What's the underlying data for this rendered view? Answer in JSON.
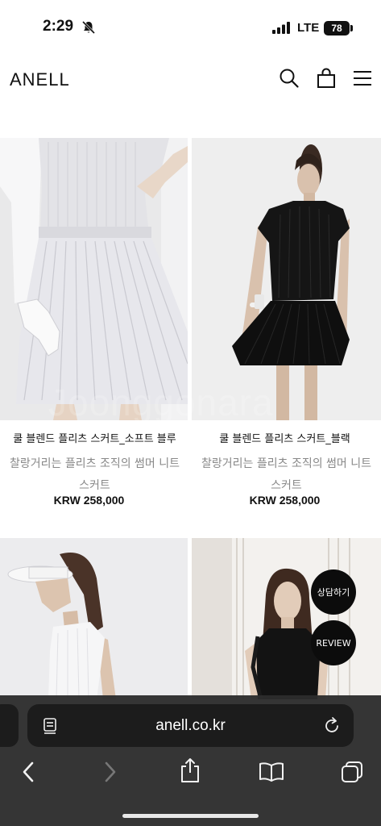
{
  "status_bar": {
    "time": "2:29",
    "network": "LTE",
    "battery": "78"
  },
  "header": {
    "logo": "ANELL",
    "icons": [
      "search-icon",
      "shopping-bag-icon",
      "hamburger-menu-icon"
    ]
  },
  "products": [
    {
      "name": "쿨 블렌드 플리츠 스커트_소프트 블루",
      "description": "찰랑거리는 플리츠 조직의 썸머 니트스커트",
      "price": "KRW 258,000"
    },
    {
      "name": "쿨 블렌드 플리츠 스커트_블랙",
      "description": "찰랑거리는 플리츠 조직의 썸머 니트스커트",
      "price": "KRW 258,000"
    }
  ],
  "watermark": "Joonggonara",
  "floating_buttons": {
    "consult": "상담하기",
    "review": "REVIEW"
  },
  "browser": {
    "url": "anell.co.kr"
  },
  "colors": {
    "browser_bar": "#2d2d2d",
    "url_field": "#1c1c1c",
    "float_button": "#0c0c0c",
    "description_text": "#888888"
  }
}
